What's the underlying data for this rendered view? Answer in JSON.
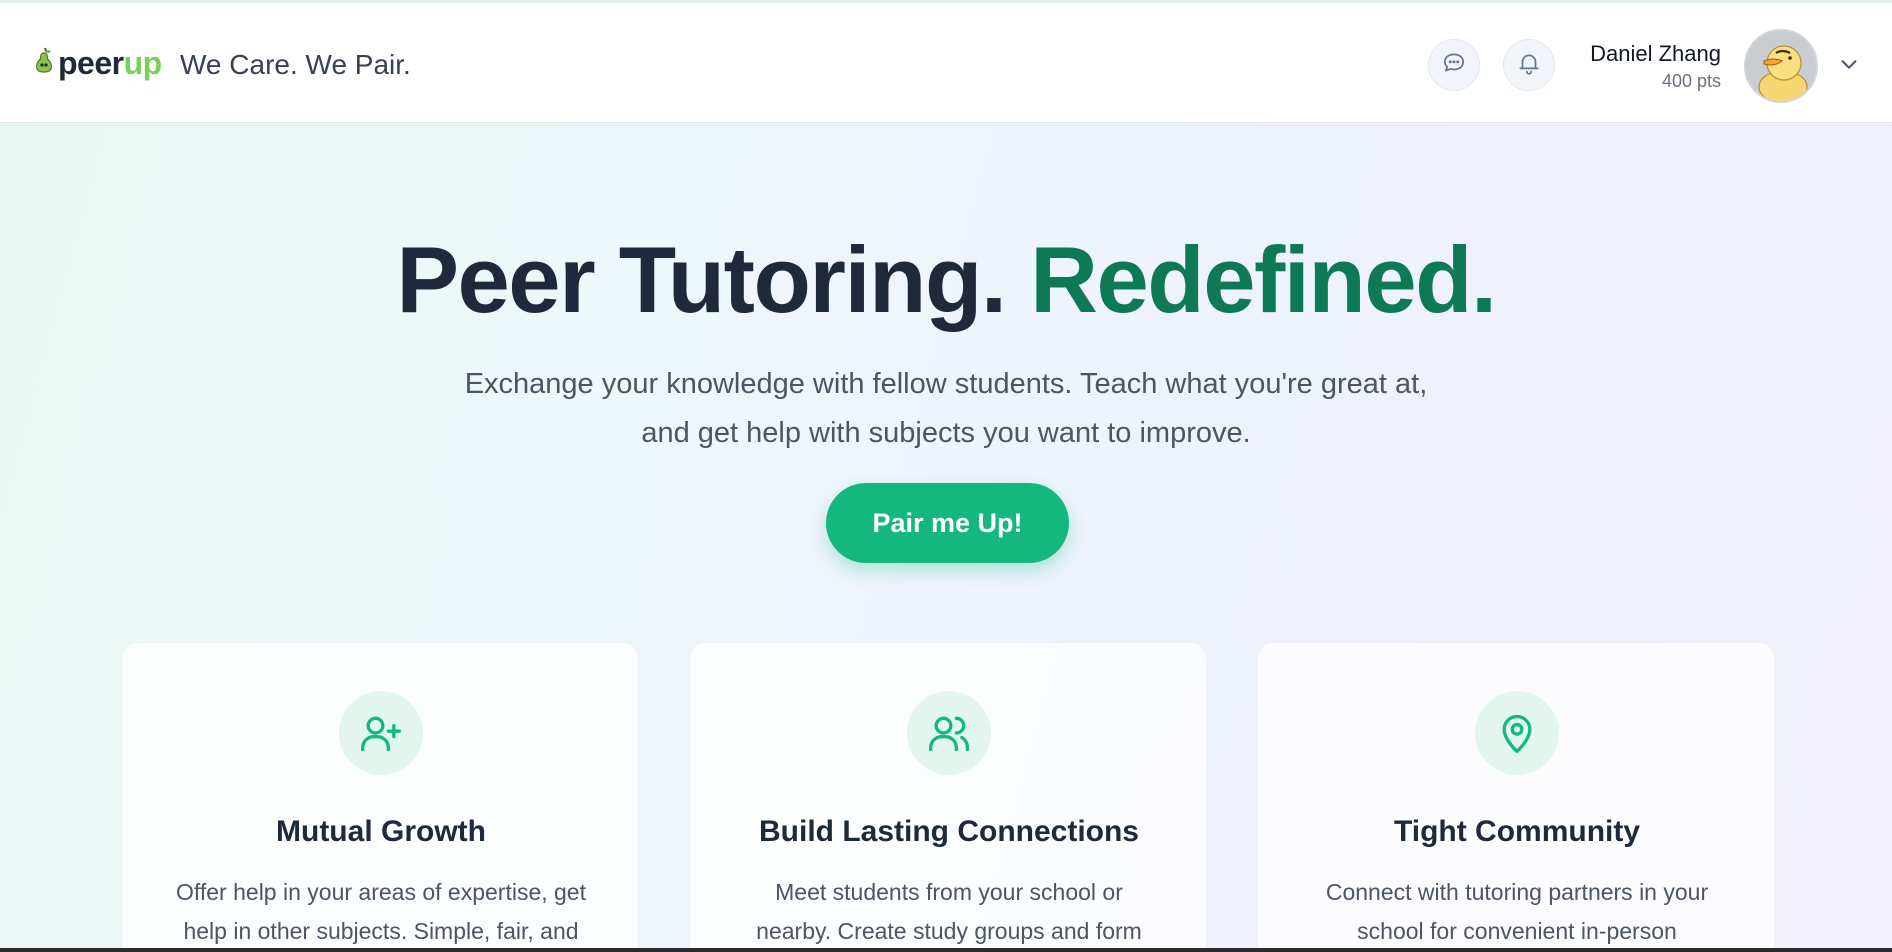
{
  "header": {
    "logo": {
      "text_dark": "peer",
      "text_accent": "up",
      "icon": "pear-icon"
    },
    "tagline": "We Care. We Pair.",
    "chat_icon": "chat-bubble-icon",
    "notification_icon": "bell-icon",
    "user": {
      "name": "Daniel Zhang",
      "points": "400 pts",
      "avatar": "duck-avatar"
    },
    "menu_icon": "chevron-down-icon"
  },
  "hero": {
    "headline_main": "Peer Tutoring. ",
    "headline_accent": "Redefined.",
    "subtitle_line1": "Exchange your knowledge with fellow students. Teach what you're great at,",
    "subtitle_line2": "and get help with subjects you want to improve.",
    "cta_label": "Pair me Up!"
  },
  "features": [
    {
      "icon": "user-plus-icon",
      "title": "Mutual Growth",
      "line1": "Offer help in your areas of expertise, get",
      "line2": "help in other subjects. Simple, fair, and"
    },
    {
      "icon": "users-icon",
      "title": "Build Lasting Connections",
      "line1": "Meet students from your school or",
      "line2": "nearby. Create study groups and form"
    },
    {
      "icon": "map-pin-icon",
      "title": "Tight Community",
      "line1": "Connect with tutoring partners in your",
      "line2": "school for convenient in-person"
    }
  ],
  "colors": {
    "brand_green": "#14b87f",
    "headline_accent": "#0d7a55",
    "logo_up": "#7ccf5a",
    "text_dark": "#1e293b"
  }
}
